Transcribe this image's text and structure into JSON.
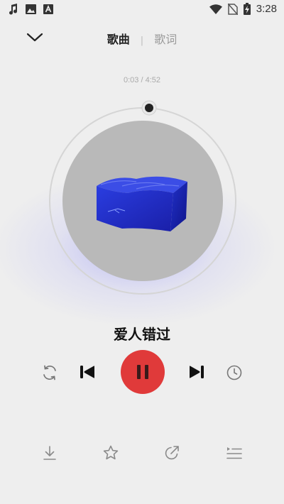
{
  "status_bar": {
    "time": "3:28",
    "left_icons": [
      "music-note-icon",
      "image-icon",
      "text-a-icon"
    ],
    "right_icons": [
      "wifi-icon",
      "no-sim-icon",
      "battery-charging-icon"
    ]
  },
  "header": {
    "tabs": [
      {
        "label": "歌曲",
        "active": true
      },
      {
        "label": "歌词",
        "active": false
      }
    ],
    "separator": "|"
  },
  "player": {
    "progress_text": "0:03 / 4:52",
    "progress_fraction": 0.0104,
    "song_title": "爱人错过",
    "state": "playing"
  },
  "colors": {
    "accent": "#e03a3a",
    "background": "#eeeeee",
    "disc": "#b9b9b9",
    "glow": "#aaaaf5"
  },
  "controls": [
    "repeat-icon",
    "previous-icon",
    "pause-icon",
    "next-icon",
    "timer-icon"
  ],
  "bottom_actions": [
    "download-icon",
    "star-icon",
    "share-icon",
    "playlist-icon"
  ]
}
